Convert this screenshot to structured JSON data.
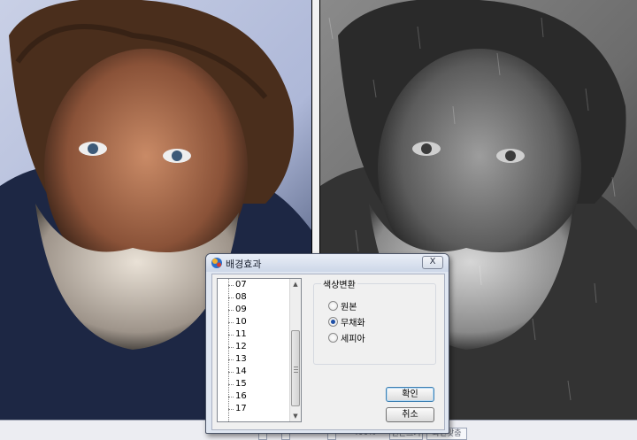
{
  "dialog": {
    "title": "배경효과",
    "close_label": "X",
    "list": {
      "items": [
        "07",
        "08",
        "09",
        "10",
        "11",
        "12",
        "13",
        "14",
        "15",
        "16",
        "17"
      ]
    },
    "color_group": {
      "label": "색상변환",
      "options": [
        {
          "label": "원본",
          "selected": false
        },
        {
          "label": "무채화",
          "selected": true
        },
        {
          "label": "세피아",
          "selected": false
        }
      ]
    },
    "ok_label": "확인",
    "cancel_label": "취소"
  },
  "status_bar": {
    "zoom": "400%",
    "fit_label": "원본크기",
    "fit_window_label": "화면맞춤"
  },
  "colors": {
    "accent": "#1e4fa6",
    "dialog_bg": "#dfe6f1",
    "client_bg": "#f0f0f0"
  },
  "icons": [
    "app-icon",
    "close-icon",
    "scroll-up-icon",
    "scroll-down-icon"
  ]
}
